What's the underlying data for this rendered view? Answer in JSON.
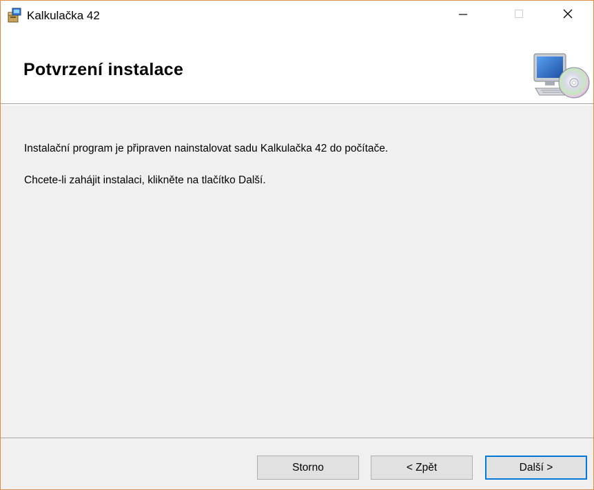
{
  "window": {
    "title": "Kalkulačka 42",
    "app_icon": "installer-package-icon",
    "controls": {
      "minimize": "minimize-icon",
      "maximize": "maximize-icon",
      "close": "close-icon"
    }
  },
  "banner": {
    "title": "Potvrzení instalace",
    "art": "computer-cd-icon"
  },
  "content": {
    "line1": "Instalační program je připraven nainstalovat sadu Kalkulačka 42 do počítače.",
    "line2": "Chcete-li zahájit instalaci, klikněte na tlačítko Další."
  },
  "footer": {
    "cancel_label": "Storno",
    "back_label": "< Zpět",
    "next_label": "Další >"
  },
  "colors": {
    "window_border": "#e38c48",
    "focus_border": "#0078d7",
    "dialog_bg": "#f0f0f0",
    "button_bg": "#e1e1e1"
  }
}
